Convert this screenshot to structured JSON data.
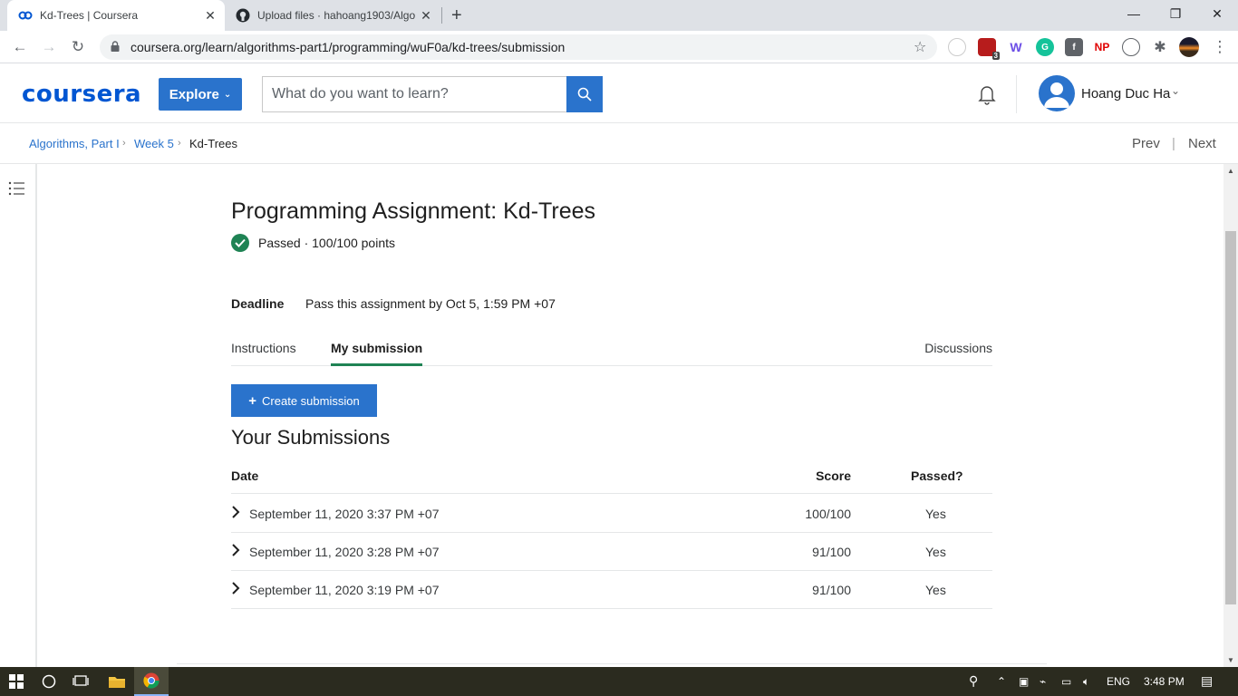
{
  "browser": {
    "tabs": [
      {
        "title": "Kd-Trees | Coursera",
        "active": true,
        "favicon": "coursera-icon"
      },
      {
        "title": "Upload files · hahoang1903/Algo",
        "active": false,
        "favicon": "github-icon"
      }
    ],
    "new_tab": "+",
    "window_controls": {
      "minimize": "—",
      "maximize": "❐",
      "close": "✕"
    },
    "url": "coursera.org/learn/algorithms-part1/programming/wuF0a/kd-trees/submission",
    "extensions": [
      {
        "name": "extension-badge-icon",
        "badge": "3",
        "color": "#b71c1c"
      },
      {
        "name": "grammarly-icon",
        "color": "#15c39a"
      },
      {
        "name": "np-icon",
        "label": "NP",
        "color": "#e00000"
      }
    ]
  },
  "header": {
    "logo": "coursera",
    "explore_label": "Explore",
    "search_placeholder": "What do you want to learn?",
    "user_name": "Hoang Duc Ha",
    "accent": "#2a73cc"
  },
  "breadcrumb": {
    "items": [
      "Algorithms, Part I",
      "Week 5",
      "Kd-Trees"
    ],
    "prev": "Prev",
    "next": "Next"
  },
  "assignment": {
    "title": "Programming Assignment: Kd-Trees",
    "status": "Passed · 100/100 points",
    "deadline_label": "Deadline",
    "deadline_text": "Pass this assignment by Oct 5, 1:59 PM +07",
    "tabs": {
      "instructions": "Instructions",
      "my_submission": "My submission",
      "discussions": "Discussions"
    },
    "create_label": "Create submission",
    "submissions_heading": "Your Submissions",
    "columns": {
      "date": "Date",
      "score": "Score",
      "passed": "Passed?"
    },
    "submissions": [
      {
        "date": "September 11, 2020 3:37 PM +07",
        "score": "100/100",
        "passed": "Yes"
      },
      {
        "date": "September 11, 2020 3:28 PM +07",
        "score": "91/100",
        "passed": "Yes"
      },
      {
        "date": "September 11, 2020 3:19 PM +07",
        "score": "91/100",
        "passed": "Yes"
      }
    ]
  },
  "taskbar": {
    "language": "ENG",
    "time": "3:48 PM"
  }
}
